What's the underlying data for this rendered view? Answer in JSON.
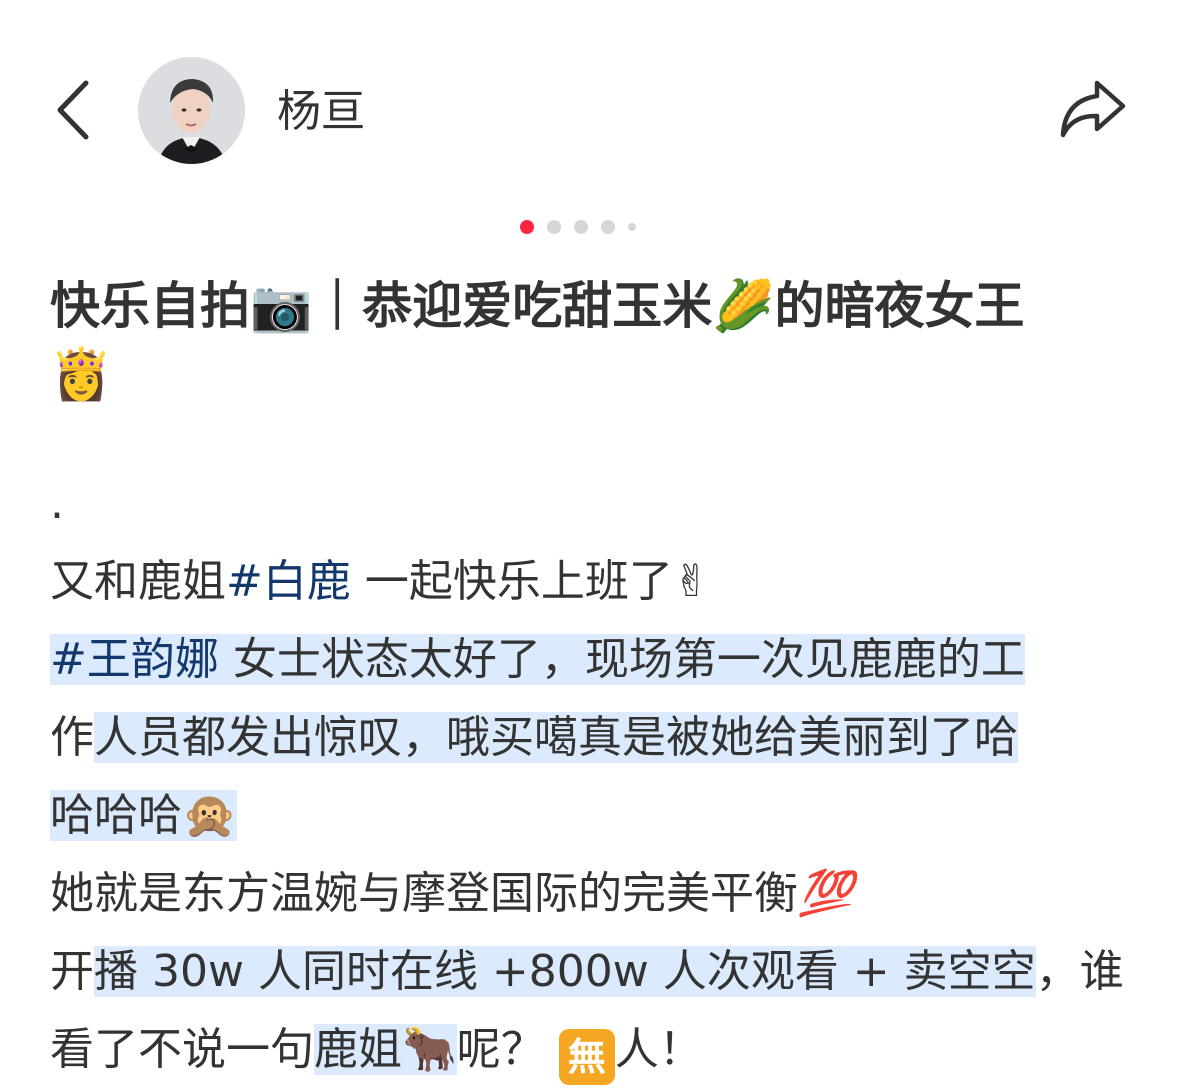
{
  "header": {
    "username": "杨亘"
  },
  "icons": {
    "back": "chevron-left-icon",
    "share": "share-arrow-icon",
    "camera": "camera-emoji",
    "corn": "corn-emoji",
    "princess": "princess-emoji",
    "victory": "victory-hand-emoji",
    "cover_mouth": "cover-mouth-sticker",
    "hundred": "hundred-points-emoji",
    "ox": "ox-emoji",
    "nothing": "nothing-badge-emoji"
  },
  "carousel": {
    "count": 5,
    "active": 1
  },
  "post": {
    "title_a": "快乐自拍",
    "title_emoji_camera": "📷",
    "title_b": "｜恭迎爱吃甜玉米",
    "title_emoji_corn": "🌽",
    "title_c": "的暗夜女王",
    "title_emoji_princess": "👸",
    "dot_line": ".",
    "l1_a": "又和鹿姐",
    "l1_tag": "#白鹿",
    "l1_b": " 一起快乐上班了",
    "l1_emoji": "✌",
    "l2_tag": "#王韵娜",
    "l2_b": " 女士状态太好了，现场第一次见鹿鹿的工",
    "l3_a": "作",
    "l3_b": "人员都发出惊叹，哦买噶真是被她给美丽到了哈",
    "l4_a": "哈哈哈",
    "l4_emoji": "🙊",
    "l5_a": "她就是东方温婉与摩登国际的完美平衡",
    "l5_emoji": "💯",
    "l6_a": "开",
    "l6_b": "播 30w 人同时在线 +800w 人次观看 + 卖空空",
    "l6_c": "，谁",
    "l7_a": "看了不说一句",
    "l7_b": "鹿姐",
    "l7_emoji": "🐂",
    "l7_c": "呢？",
    "l7_badge": "無",
    "l7_d": "人！"
  },
  "colors": {
    "accent": "#ff2442",
    "tag": "#13386c",
    "highlight": "#dbeafc",
    "text": "#333333"
  }
}
